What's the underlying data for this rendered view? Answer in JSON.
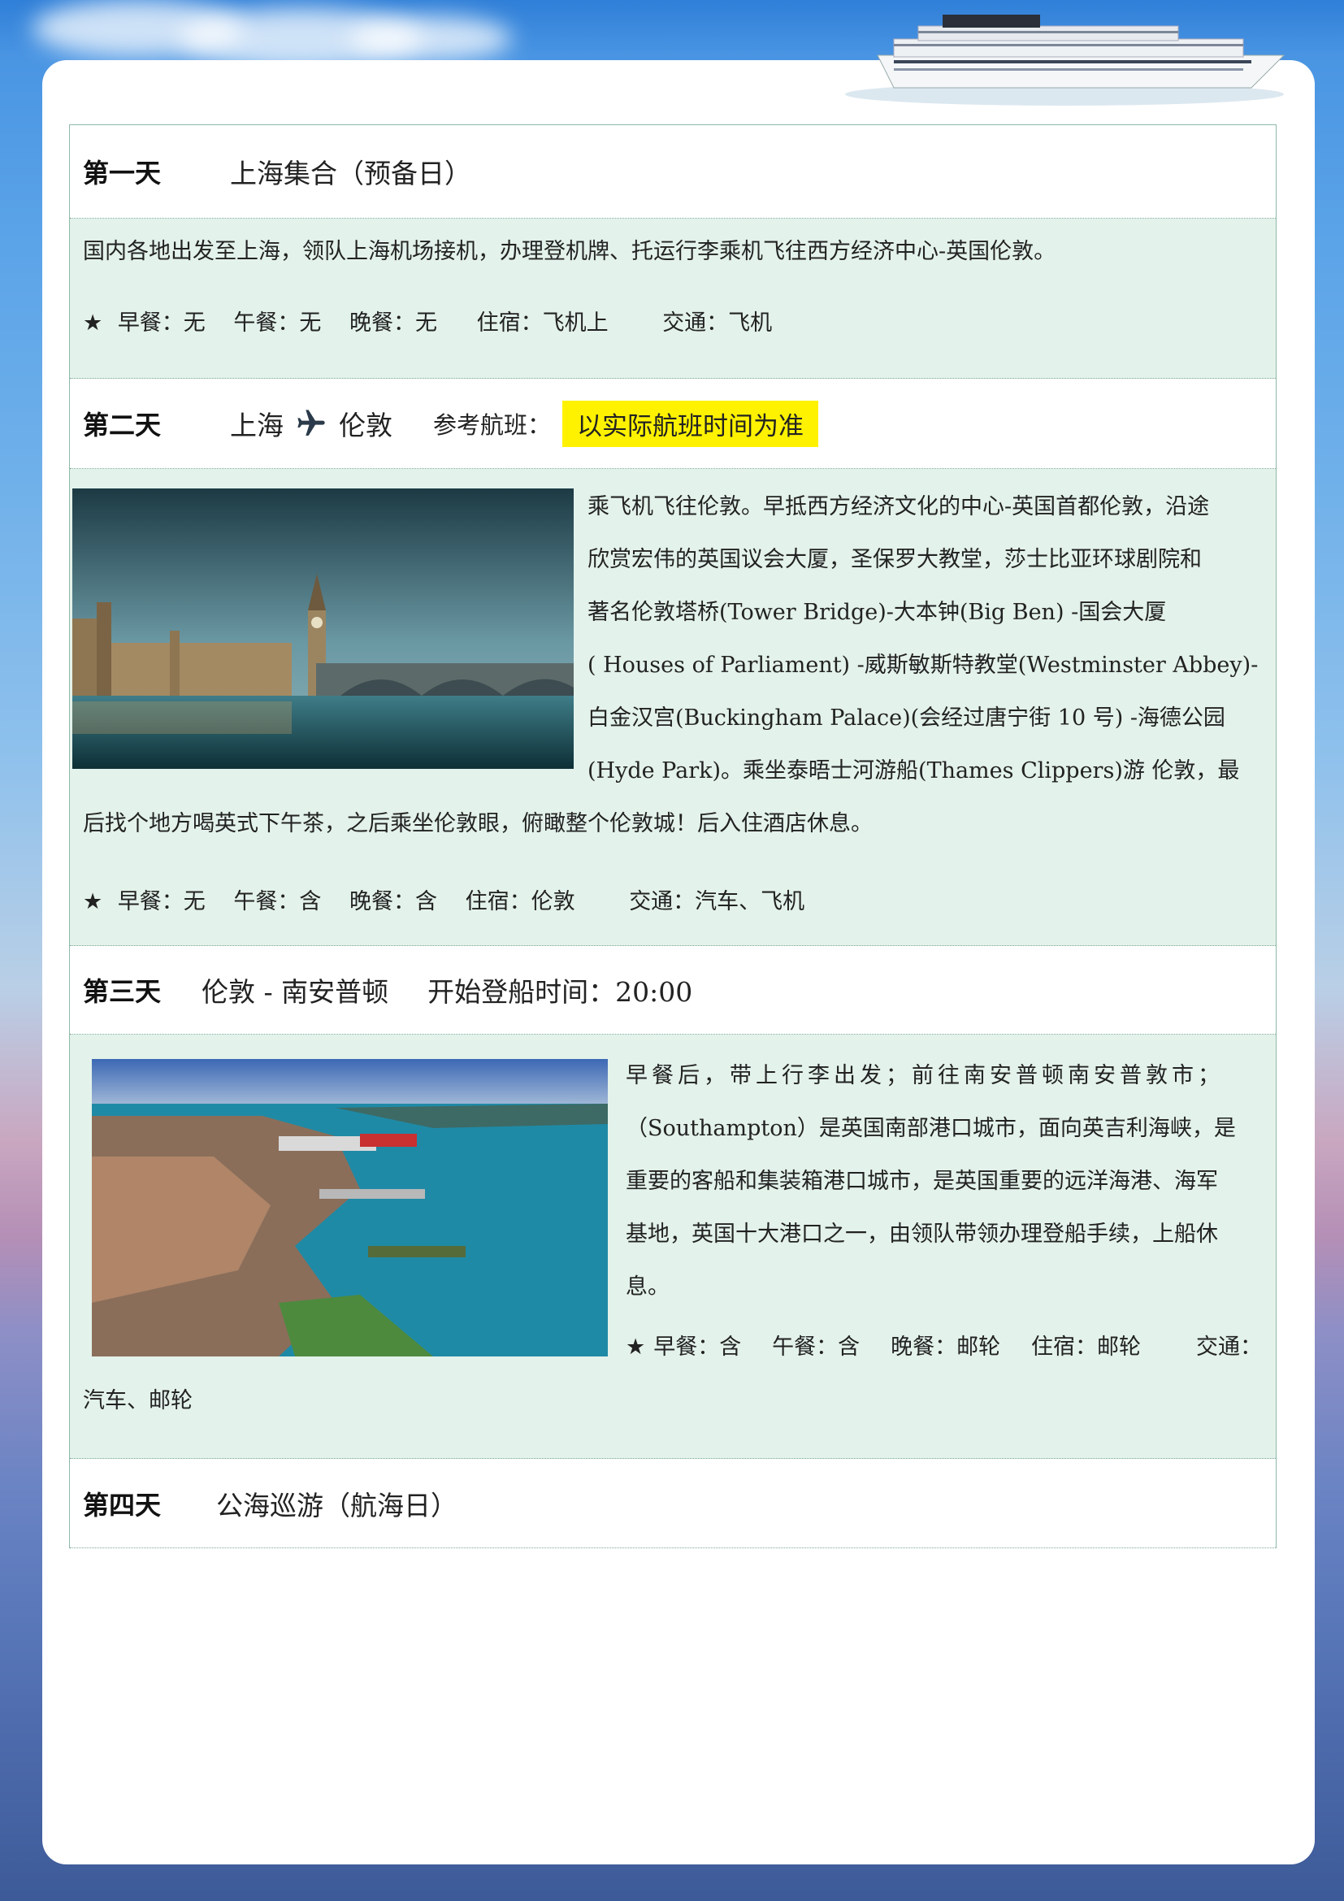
{
  "days": [
    {
      "day": "第一天",
      "title": "上海集合（预备日）",
      "desc": "国内各地出发至上海，领队上海机场接机，办理登机牌、托运行李乘机飞往西方经济中心-英国伦敦。",
      "meals": {
        "breakfast": "早餐：无",
        "lunch": "午餐：无",
        "dinner": "晚餐：无",
        "stay": "住宿：飞机上",
        "transport": "交通：飞机"
      }
    },
    {
      "day": "第二天",
      "from": "上海",
      "to": "伦敦",
      "flight_label": "参考航班：",
      "flight_note": "以实际航班时间为准",
      "desc_lines": [
        "乘飞机飞往伦敦。早抵西方经济文化的中心-英国首都伦敦，沿途",
        "欣赏宏伟的英国议会大厦，圣保罗大教堂，莎士比亚环球剧院和",
        "著名伦敦塔桥(Tower Bridge)-大本钟(Big Ben) -国会大厦",
        "( Houses of Parliament) -威斯敏斯特教堂(Westminster Abbey)-",
        "白金汉宫(Buckingham Palace)(会经过唐宁街 10 号) -海德公园",
        "(Hyde Park)。乘坐泰晤士河游船(Thames Clippers)游 伦敦，最",
        "后找个地方喝英式下午茶，之后乘坐伦敦眼，俯瞰整个伦敦城！后入住酒店休息。"
      ],
      "meals": {
        "breakfast": "早餐：无",
        "lunch": "午餐：含",
        "dinner": "晚餐：含",
        "stay": "住宿：伦敦",
        "transport": "交通：汽车、飞机"
      }
    },
    {
      "day": "第三天",
      "title": "伦敦 - 南安普顿",
      "boarding": "开始登船时间：20:00",
      "desc_lines": [
        "早餐后，带上行李出发；前往南安普顿南安普敦市；",
        "（Southampton）是英国南部港口城市，面向英吉利海峡，是",
        "重要的客船和集装箱港口城市，是英国重要的远洋海港、海军",
        "基地，英国十大港口之一，由领队带领办理登船手续，上船休",
        "息。"
      ],
      "meals": {
        "breakfast": "早餐：含",
        "lunch": "午餐：含",
        "dinner": "晚餐：邮轮",
        "stay": "住宿：邮轮",
        "transport": "交通：",
        "transport_cont": "汽车、邮轮"
      }
    },
    {
      "day": "第四天",
      "title": "公海巡游（航海日）"
    }
  ],
  "star": "★",
  "icons": {
    "plane": "airplane-icon",
    "ship": "cruise-ship-image",
    "london": "london-parliament-photo",
    "southampton": "southampton-port-photo"
  }
}
